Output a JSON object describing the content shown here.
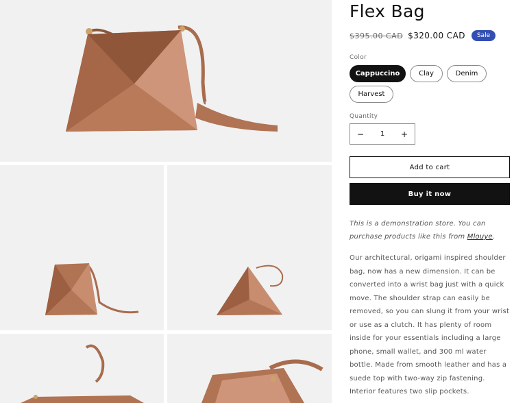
{
  "product": {
    "title": "Flex Bag",
    "price_old": "$395.00 CAD",
    "price_new": "$320.00 CAD",
    "sale_badge": "Sale"
  },
  "options": {
    "color_label": "Color",
    "colors": [
      "Cappuccino",
      "Clay",
      "Denim",
      "Harvest"
    ],
    "selected_color": "Cappuccino",
    "quantity_label": "Quantity",
    "quantity_value": "1",
    "minus_symbol": "−",
    "plus_symbol": "+"
  },
  "actions": {
    "add_to_cart": "Add to cart",
    "buy_now": "Buy it now"
  },
  "notice": {
    "text": "This is a demonstration store. You can purchase products like this from ",
    "link": "Mlouye",
    "end": "."
  },
  "description": "Our architectural, origami inspired shoulder bag, now has a new dimension. It can be converted into a wrist bag just with a quick move. The shoulder strap can easily be removed, so you can slung it from your wrist or use as a clutch. It has plenty of room inside for your essentials including a large phone, small wallet, and 300 ml water bottle. Made from smooth leather and has a suede top with two-way zip fastening. Interior features two slip pockets.",
  "colors": {
    "sale_badge_bg": "#334fb4",
    "leather": "#b07353",
    "leather_light": "#cf957a",
    "tile_bg": "#f1f1f1"
  },
  "icons": [
    "shoulder-bag-photo",
    "crossbody-bag-photo",
    "wrist-bag-photo",
    "bag-strap-photo",
    "bag-interior-photo"
  ]
}
